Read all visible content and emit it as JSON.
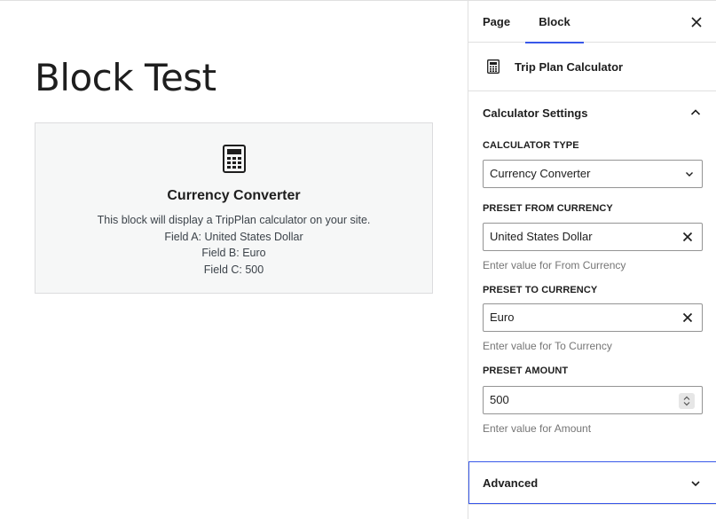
{
  "canvas": {
    "page_title": "Block Test",
    "block": {
      "icon": "calculator-icon",
      "title": "Currency Converter",
      "description": "This block will display a TripPlan calculator on your site.",
      "fields": [
        "Field A: United States Dollar",
        "Field B: Euro",
        "Field C: 500"
      ]
    }
  },
  "sidebar": {
    "tabs": [
      {
        "label": "Page",
        "active": false
      },
      {
        "label": "Block",
        "active": true
      }
    ],
    "close_icon": "close-icon",
    "block_card": {
      "icon": "calculator-icon",
      "title": "Trip Plan Calculator"
    },
    "panel": {
      "title": "Calculator Settings",
      "expanded": true,
      "calculator_type": {
        "label": "CALCULATOR TYPE",
        "value": "Currency Converter"
      },
      "from_currency": {
        "label": "PRESET FROM CURRENCY",
        "value": "United States Dollar",
        "help": "Enter value for From Currency"
      },
      "to_currency": {
        "label": "PRESET TO CURRENCY",
        "value": "Euro",
        "help": "Enter value for To Currency"
      },
      "amount": {
        "label": "PRESET AMOUNT",
        "value": "500",
        "help": "Enter value for Amount"
      }
    },
    "advanced": {
      "title": "Advanced",
      "expanded": false
    }
  },
  "colors": {
    "accent": "#3858e9",
    "block_bg": "#f6f7f7",
    "border": "#e0e0e0",
    "help_text": "#757575"
  }
}
